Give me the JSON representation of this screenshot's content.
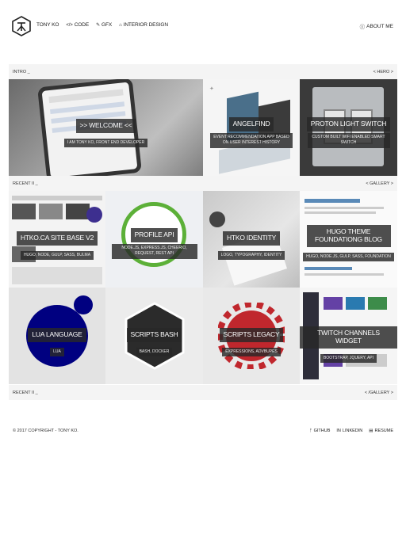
{
  "header": {
    "brand": "TONY KO",
    "nav": [
      {
        "icon": "code-icon",
        "glyph": "</>",
        "label": "CODE"
      },
      {
        "icon": "brush-icon",
        "glyph": "✎",
        "label": "GFX"
      },
      {
        "icon": "building-icon",
        "glyph": "⌂",
        "label": "INTERIOR DESIGN"
      }
    ],
    "about": {
      "icon": "info-circle-icon",
      "glyph": "ⓘ",
      "label": "ABOUT ME"
    }
  },
  "sections": [
    {
      "left": "INTRO _",
      "right": "< HERO >"
    },
    {
      "left": "RECENT II _",
      "right": "< GALLERY >"
    },
    {
      "left": "RECENT II _",
      "right": "< /GALLERY >"
    }
  ],
  "hero": [
    {
      "title": ">> WELCOME <<",
      "subtitle": "I AM TONY KO, FRONT END DEVELOPER"
    },
    {
      "title": "ANGELFIND",
      "subtitle": "EVENT RECOMMENDATION APP BASED ON USER INTEREST HISTORY"
    },
    {
      "title": "PROTON LIGHT SWITCH",
      "subtitle": "CUSTOM BUILT WIFI ENABLED SMART SWITCH"
    }
  ],
  "gallery": [
    {
      "title": "HTKO.CA SITE BASE V2",
      "subtitle": "HUGO, NODE, GULP, SASS, BULMA"
    },
    {
      "title": "PROFILE API",
      "subtitle": "NODE.JS, EXPRESS.JS, CHEERIO, REQUEST, REST API"
    },
    {
      "title": "HTKO IDENTITY",
      "subtitle": "LOGO, TYPOGRAPHY, IDENTITY"
    },
    {
      "title": "HUGO THEME FOUNDATIONG BLOG",
      "subtitle": "HUGO, NODE.JS, GULP, SASS, FOUNDATION"
    },
    {
      "title": "LUA LANGUAGE",
      "subtitle": "LUA"
    },
    {
      "title": "SCRIPTS BASH",
      "subtitle": "BASH, DOCKER"
    },
    {
      "title": "SCRIPTS LEGACY",
      "subtitle": "EXPRESSIONS, ADVBUPES"
    },
    {
      "title": "TWITCH CHANNELS WIDGET",
      "subtitle": "BOOTSTRAP, JQUERY, API"
    }
  ],
  "footer": {
    "copyright": "© 2017 COPYRIGHT - TONY KO.",
    "links": [
      {
        "icon": "github-icon",
        "glyph": "ᚠ",
        "label": "GITHUB"
      },
      {
        "icon": "linkedin-icon",
        "glyph": "in",
        "label": "LINKEDIN"
      },
      {
        "icon": "resume-icon",
        "glyph": "▤",
        "label": "RESUME"
      }
    ]
  },
  "colors": {
    "bar": "#f4f4f4",
    "caption_bg": "#2a2a2a",
    "twitch": "#6441a5",
    "lua": "#000080",
    "legacy_red": "#c0272d"
  }
}
